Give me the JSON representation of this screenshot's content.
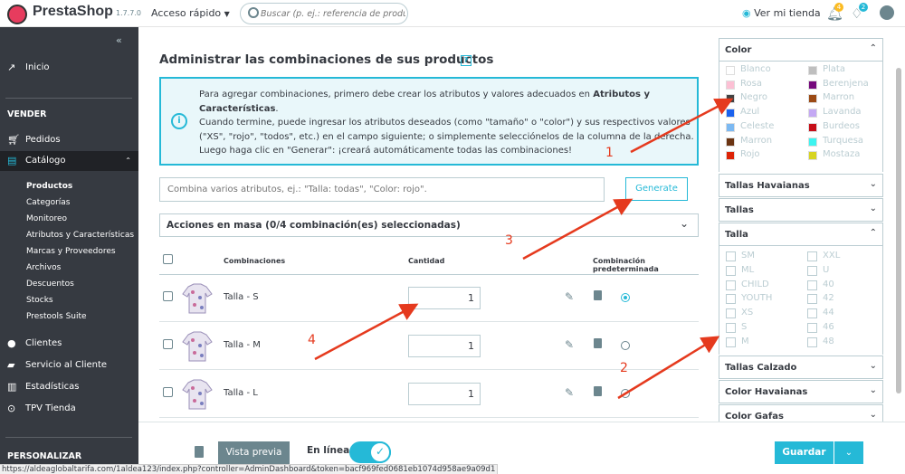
{
  "topbar": {
    "brand": "PrestaShop",
    "version": "1.7.7.0",
    "quick_access": "Acceso rápido",
    "search_placeholder": "Buscar (p. ej.: referencia de producto, n",
    "view_store": "Ver mi tienda",
    "orders_badge": "4",
    "customers_badge": "2"
  },
  "sidebar": {
    "home": "Inicio",
    "sell_header": "VENDER",
    "orders": "Pedidos",
    "catalog": "Catálogo",
    "catalog_sub": [
      "Productos",
      "Categorías",
      "Monitoreo",
      "Atributos y Características",
      "Marcas y Proveedores",
      "Archivos",
      "Descuentos",
      "Stocks",
      "Prestools Suite"
    ],
    "customers": "Clientes",
    "service": "Servicio al Cliente",
    "stats": "Estadísticas",
    "pos": "TPV Tienda",
    "personalize_header": "PERSONALIZAR"
  },
  "main": {
    "title": "Administrar las combinaciones de sus productos",
    "help": "?",
    "info_text_1": "Para agregar combinaciones, primero debe crear los atributos y valores adecuados en ",
    "info_link": "Atributos y Características",
    "info_text_2": ".",
    "info_text_3": "Cuando termine, puede ingresar los atributos deseados (como \"tamaño\" o \"color\") y sus respectivos valores (\"XS\", \"rojo\", \"todos\", etc.) en el campo siguiente; o simplemente selecciónelos de la columna de la derecha. Luego haga clic en \"Generar\": ¡creará automáticamente todas las combinaciones!",
    "combine_placeholder": "Combina varios atributos, ej.: \"Talla: todas\", \"Color: rojo\".",
    "generate": "Generate",
    "bulk_actions": "Acciones en masa (0/4 combinación(es) seleccionadas)",
    "col_combinations": "Combinaciones",
    "col_quantity": "Cantidad",
    "col_default": "Combinación predeterminada",
    "rows": [
      {
        "name": "Talla - S",
        "qty": "1",
        "default": true
      },
      {
        "name": "Talla - M",
        "qty": "1",
        "default": false
      },
      {
        "name": "Talla - L",
        "qty": "1",
        "default": false
      }
    ]
  },
  "panel": {
    "color_title": "Color",
    "colors": [
      {
        "name": "Blanco",
        "hex": "#ffffff"
      },
      {
        "name": "Plata",
        "hex": "#bfbfbf"
      },
      {
        "name": "Rosa",
        "hex": "#fcc0d4"
      },
      {
        "name": "Berenjena",
        "hex": "#75097c"
      },
      {
        "name": "Negro",
        "hex": "#434343"
      },
      {
        "name": "Marron",
        "hex": "#9b4a14"
      },
      {
        "name": "Azul",
        "hex": "#1b62ee"
      },
      {
        "name": "Lavanda",
        "hex": "#c4a9f4"
      },
      {
        "name": "Celeste",
        "hex": "#7cb9f2"
      },
      {
        "name": "Burdeos",
        "hex": "#c60e18"
      },
      {
        "name": "Marron",
        "hex": "#6b3412"
      },
      {
        "name": "Turquesa",
        "hex": "#3df4f0"
      },
      {
        "name": "Rojo",
        "hex": "#dd2306"
      },
      {
        "name": "Mostaza",
        "hex": "#d7d421"
      }
    ],
    "havaianas": "Tallas Havaianas",
    "tallas": "Tallas",
    "talla": "Talla",
    "sizes": [
      "SM",
      "XXL",
      "ML",
      "U",
      "CHILD",
      "40",
      "YOUTH",
      "42",
      "XS",
      "44",
      "S",
      "46",
      "M",
      "48"
    ],
    "calzado": "Tallas Calzado",
    "color_havaianas": "Color Havaianas",
    "color_gafas": "Color Gafas"
  },
  "footer": {
    "preview": "Vista previa",
    "online": "En línea",
    "save": "Guardar"
  },
  "status_url": "https://aldeaglobaltarifa.com/1aldea123/index.php?controller=AdminDashboard&token=bacf969fed0681eb1074d958ae9a09d1",
  "annotations": [
    "1",
    "2",
    "3",
    "4"
  ],
  "colors": {
    "accent": "#25b9d7",
    "sidebar_bg": "#363a41",
    "annotation": "#e53a1e"
  }
}
